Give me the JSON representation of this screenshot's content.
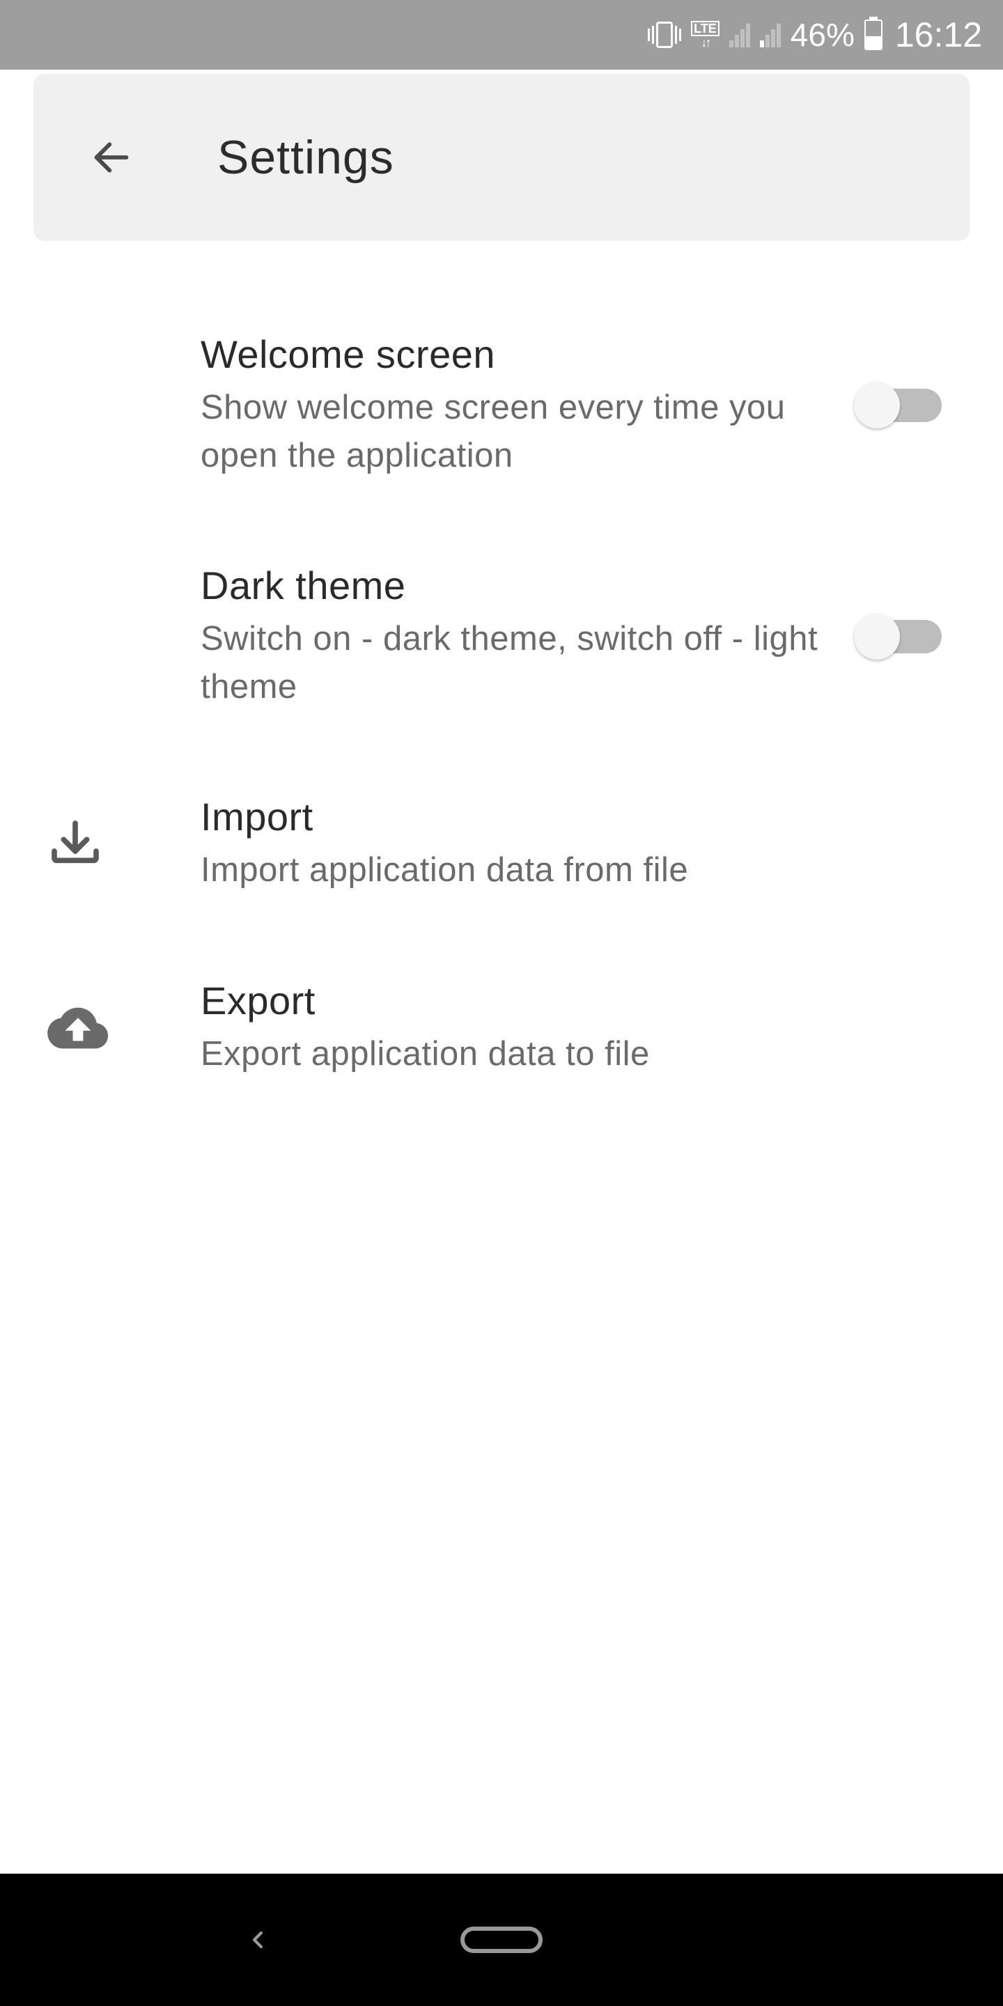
{
  "status": {
    "battery_percent": "46%",
    "time": "16:12",
    "lte_label": "LTE"
  },
  "header": {
    "title": "Settings"
  },
  "settings": {
    "welcome": {
      "title": "Welcome screen",
      "description": "Show welcome screen every time you open the application",
      "enabled": false
    },
    "dark_theme": {
      "title": "Dark theme",
      "description": "Switch on - dark theme, switch off - light theme",
      "enabled": false
    },
    "import": {
      "title": "Import",
      "description": "Import application data from file"
    },
    "export": {
      "title": "Export",
      "description": "Export application data to file"
    }
  }
}
